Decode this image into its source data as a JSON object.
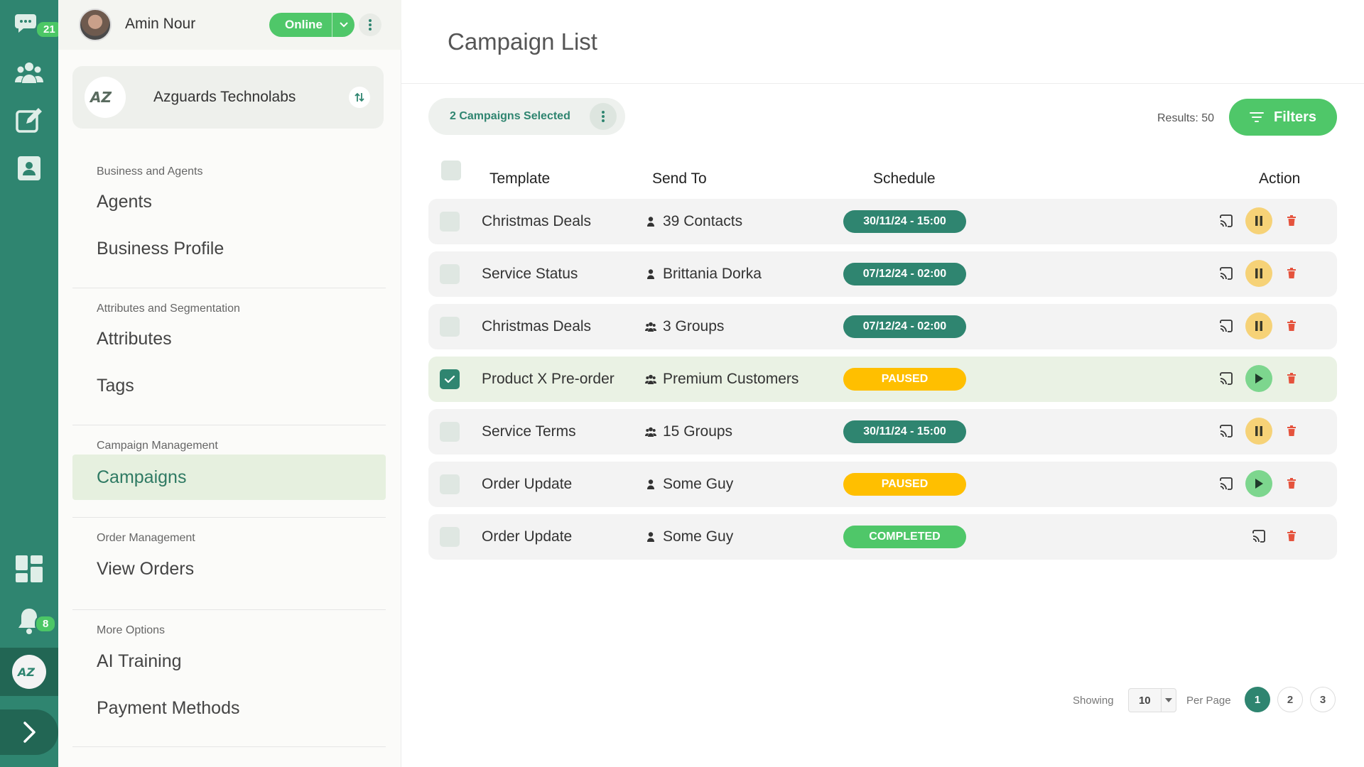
{
  "colors": {
    "rail": "#2f8570",
    "accent_green": "#4fc769",
    "teal_dark": "#2f8570",
    "paused_yellow": "#ffbf00",
    "completed_green": "#4fc769",
    "pause_btn": "#f6d277",
    "play_btn": "#7dd68e",
    "delete_red": "#e5533d"
  },
  "rail": {
    "chats_badge": "21",
    "notifications_badge": "8",
    "icons": [
      "chat-bubbles-icon",
      "contacts-group-icon",
      "edit-icon",
      "contact-card-icon",
      "dashboard-icon",
      "bell-icon",
      "business-logo-icon",
      "chevron-right-icon"
    ]
  },
  "user": {
    "name": "Amin Nour",
    "status": "Online"
  },
  "business": {
    "name": "Azguards Technolabs",
    "logo_text": "AZ"
  },
  "sidebar": {
    "sections": [
      {
        "title": "Business and Agents",
        "items": [
          "Agents",
          "Business Profile"
        ]
      },
      {
        "title": "Attributes and Segmentation",
        "items": [
          "Attributes",
          "Tags"
        ]
      },
      {
        "title": "Campaign Management",
        "items": [
          "Campaigns"
        ],
        "active": "Campaigns"
      },
      {
        "title": "Order Management",
        "items": [
          "View Orders"
        ]
      },
      {
        "title": "More Options",
        "items": [
          "AI Training",
          "Payment Methods"
        ]
      }
    ]
  },
  "main": {
    "title": "Campaign List",
    "selected_label": "2 Campaigns Selected",
    "results_label": "Results: 50",
    "filters_label": "Filters",
    "columns": [
      "Template",
      "Send To",
      "Schedule",
      "Action"
    ],
    "rows": [
      {
        "template": "Christmas Deals",
        "send_to": "39 Contacts",
        "recipient_type": "person",
        "schedule": "30/11/24 - 15:00",
        "state": "scheduled",
        "checked": false
      },
      {
        "template": "Service Status",
        "send_to": "Brittania Dorka",
        "recipient_type": "person",
        "schedule": "07/12/24 - 02:00",
        "state": "scheduled",
        "checked": false
      },
      {
        "template": "Christmas Deals",
        "send_to": "3 Groups",
        "recipient_type": "group",
        "schedule": "07/12/24 - 02:00",
        "state": "scheduled",
        "checked": false
      },
      {
        "template": "Product X Pre-order",
        "send_to": "Premium Customers",
        "recipient_type": "group",
        "schedule": "PAUSED",
        "state": "paused",
        "checked": true
      },
      {
        "template": "Service Terms",
        "send_to": "15 Groups",
        "recipient_type": "group",
        "schedule": "30/11/24 - 15:00",
        "state": "scheduled",
        "checked": false
      },
      {
        "template": "Order Update",
        "send_to": "Some Guy",
        "recipient_type": "person",
        "schedule": "PAUSED",
        "state": "paused",
        "checked": false
      },
      {
        "template": "Order Update",
        "send_to": "Some Guy",
        "recipient_type": "person",
        "schedule": "COMPLETED",
        "state": "completed",
        "checked": false
      }
    ]
  },
  "pagination": {
    "showing_label": "Showing",
    "per_page_value": "10",
    "per_page_label": "Per Page",
    "pages": [
      "1",
      "2",
      "3"
    ],
    "current": "1"
  }
}
